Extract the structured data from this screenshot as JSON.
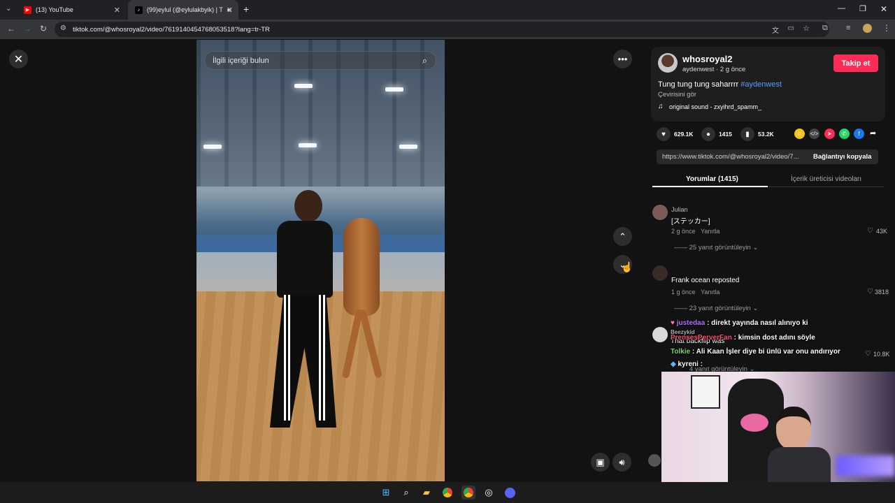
{
  "browser": {
    "tabs": [
      {
        "label": "(13) YouTube",
        "active": false
      },
      {
        "label": "(99)eylul (@eylulakbyik) | T",
        "active": true
      }
    ],
    "url": "tiktok.com/@whosroyal2/video/7619140454768053518?lang=tr-TR"
  },
  "video": {
    "search_placeholder": "İlgili içeriği bulun"
  },
  "post": {
    "username": "whosroyal2",
    "subline": "aydenwest · 2 g önce",
    "follow_label": "Takip et",
    "caption": "Tung tung tung saharrrr",
    "hashtag": "#aydenwest",
    "translate": "Çevirisini gör",
    "sound": "original sound - zxyihrd_spamm_",
    "likes": "629.1K",
    "comments": "1415",
    "saves": "53.2K",
    "link": "https://www.tiktok.com/@whosroyal2/video/7...",
    "copy_label": "Bağlantıyı kopyala"
  },
  "tabs": {
    "comments": "Yorumlar (1415)",
    "creator_videos": "İçerik üreticisi videoları"
  },
  "comments": [
    {
      "user": "Julian",
      "text": "[ステッカー]",
      "time": "2 g önce",
      "reply": "Yanıtla",
      "likes": "43K",
      "replies": "25 yanıt görüntüleyin"
    },
    {
      "user": "",
      "text": "Frank ocean reposted",
      "time": "1 g önce",
      "reply": "Yanıtla",
      "likes": "3818",
      "replies": "23 yanıt görüntüleyin"
    },
    {
      "likes": "10.8K",
      "replies": "4 yanıt görüntüleyin"
    }
  ],
  "chat_overlay": [
    {
      "name": "justedaa",
      "msg": ": direkt yayında nasıl alınıyo ki",
      "color": "#b06cff"
    },
    {
      "name": "Beezykid",
      "msg": "",
      "color": "#b0b0b0"
    },
    {
      "name": "",
      "msg": "That backflip was",
      "color": "#ffffff"
    },
    {
      "name": "PrensesPerverFan",
      "msg": ": kimsin dost adını söyle",
      "color": "#ff4d6d"
    },
    {
      "name": "Tolkie",
      "msg": ": Ali Kaan İşler diye bi ünlü var onu andırıyor",
      "color": "#7ad36b"
    },
    {
      "name": "kyreni",
      "msg": ":",
      "color": "#ffffff"
    }
  ],
  "colors": {
    "follow": "#fe2c55",
    "link": "#5a9cff",
    "panel": "#121212"
  }
}
